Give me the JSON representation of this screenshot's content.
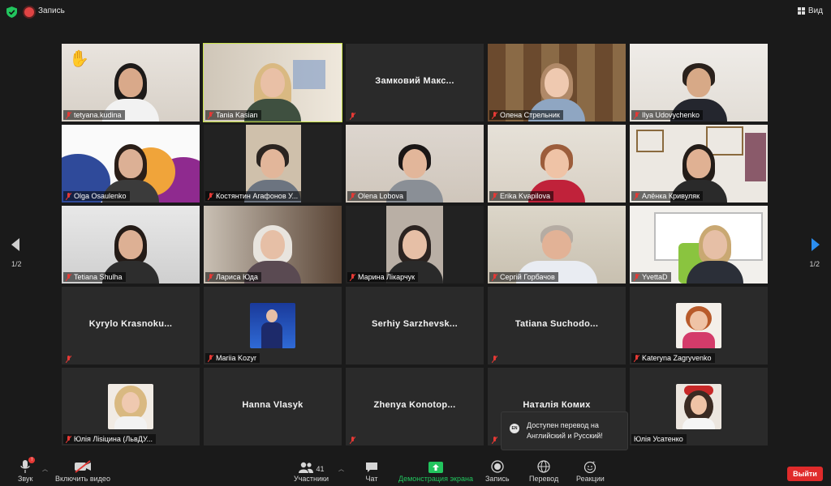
{
  "topbar": {
    "record_label": "Запись",
    "view_label": "Вид"
  },
  "pager": {
    "left": "1/2",
    "right": "1/2"
  },
  "participants": [
    {
      "name": "tetyana.kudina"
    },
    {
      "name": "Tania Kasian"
    },
    {
      "name": "",
      "display_name": "Замковий Макс..."
    },
    {
      "name": "Олена Стрельник"
    },
    {
      "name": "Ilya Udovychenko"
    },
    {
      "name": "Olga Osaulenko"
    },
    {
      "name": "Костянтин Агафонов У..."
    },
    {
      "name": "Olena Lobova"
    },
    {
      "name": "Erika Kvapilova"
    },
    {
      "name": "Алёнка Кривуляк"
    },
    {
      "name": "Tetiana Shulha"
    },
    {
      "name": "Лариса Юда"
    },
    {
      "name": "Марина Лікарчук"
    },
    {
      "name": "Сергій Горбачов"
    },
    {
      "name": "YvettaD"
    },
    {
      "name": "",
      "display_name": "Kyrylo  Krasnoku..."
    },
    {
      "name": "Mariia Kozyr"
    },
    {
      "name": "",
      "display_name": "Serhiy  Sarzhevsk..."
    },
    {
      "name": "",
      "display_name": "Tatiana  Suchodo..."
    },
    {
      "name": "Kateryna Zagryvenko"
    },
    {
      "name": "Юлія Ліsіцина (ЛьвДУ..."
    },
    {
      "name": "",
      "display_name": "Hanna Vlasyk"
    },
    {
      "name": "",
      "display_name": "Zhenya  Konotop..."
    },
    {
      "name": "",
      "display_name": "Наталія Комих"
    },
    {
      "name": "Юлія Усатенко"
    }
  ],
  "toast": {
    "lang": "EN",
    "text": "Доступен перевод на Английский и Русский!"
  },
  "toolbar": {
    "audio": "Звук",
    "video": "Включить видео",
    "participants": "Участники",
    "participants_count": "41",
    "chat": "Чат",
    "share": "Демонстрация экрана",
    "record": "Запись",
    "translate": "Перевод",
    "reactions": "Реакции",
    "leave": "Выйти",
    "audio_badge": "!"
  },
  "colors": {
    "accent_green": "#22c55e",
    "leave_red": "#e02b2b",
    "active_speaker": "#c9e34a",
    "page_arrow": "#2b8ef0"
  }
}
